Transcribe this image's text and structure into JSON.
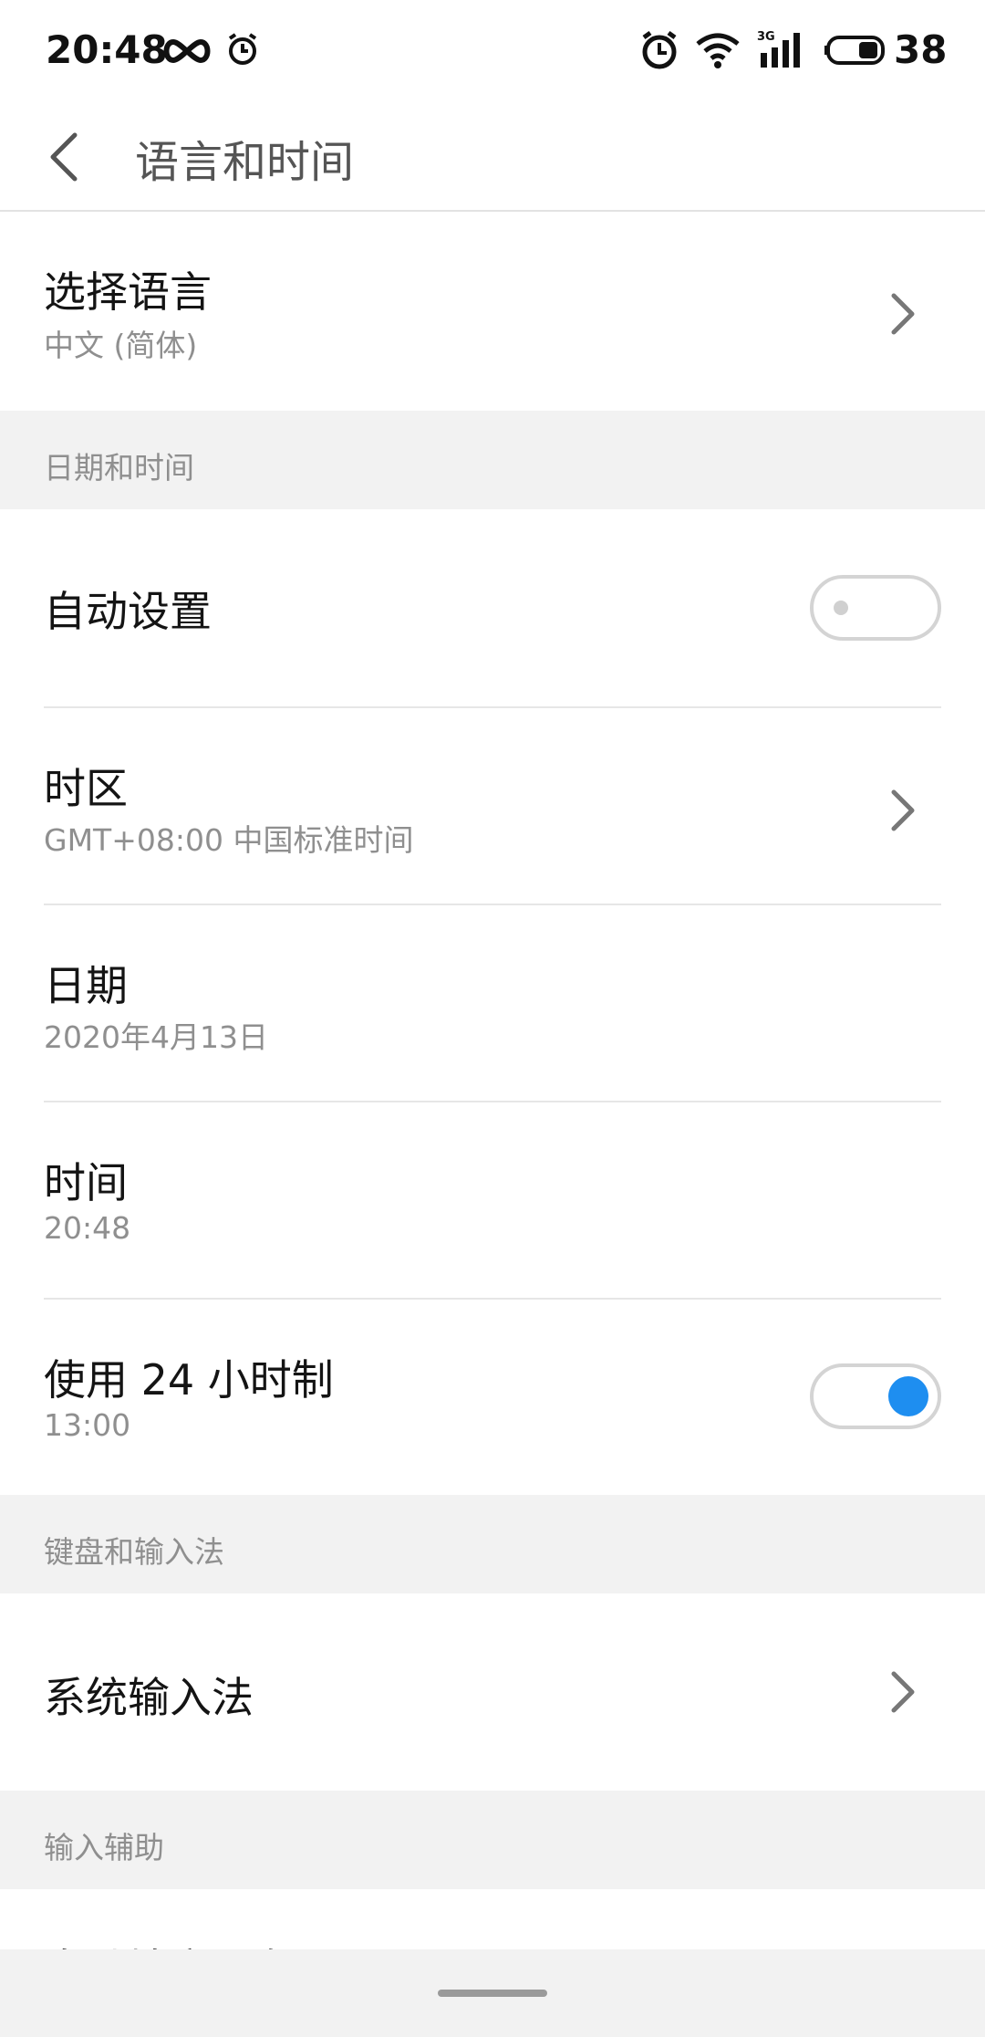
{
  "status_bar": {
    "time": "20:48",
    "battery": "38",
    "icons": [
      "infinity-icon",
      "alarm-clock-icon",
      "alarm-icon",
      "wifi-icon",
      "signal-3g-icon",
      "battery-icon"
    ]
  },
  "header": {
    "title": "语言和时间",
    "back_icon": "back-arrow-icon"
  },
  "language": {
    "title": "选择语言",
    "value": "中文 (简体)"
  },
  "sections": {
    "datetime": "日期和时间",
    "keyboard": "键盘和输入法",
    "assist": "输入辅助"
  },
  "datetime": {
    "auto_title": "自动设置",
    "auto_enabled": false,
    "timezone_title": "时区",
    "timezone_value": "GMT+08:00 中国标准时间",
    "date_title": "日期",
    "date_value": "2020年4月13日",
    "time_title": "时间",
    "time_value": "20:48",
    "h24_title": "使用 24 小时制",
    "h24_value": "13:00",
    "h24_enabled": true
  },
  "keyboard": {
    "system_ime_title": "系统输入法"
  },
  "assist": {
    "partial_title": "自动填充服务"
  },
  "colors": {
    "accent": "#1e8ef0",
    "section_bg": "#f2f2f2",
    "secondary_text": "#8f8f8f"
  }
}
